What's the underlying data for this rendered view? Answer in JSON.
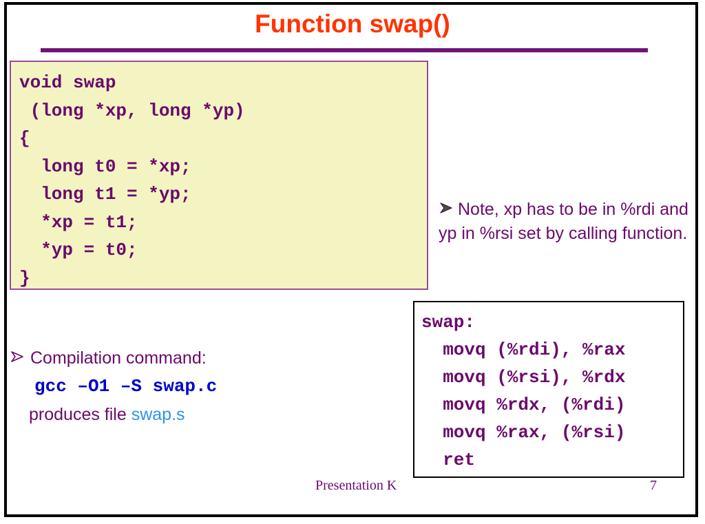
{
  "slide": {
    "title": "Function swap()",
    "accent_title_color": "#FF3300",
    "accent_rule_color": "#70127A",
    "body_text_color": "#6B0A6B",
    "code_bg_color": "#F4F4C2",
    "code_border_color": "#9B4A9B",
    "command_color": "#0000CC",
    "filename_color": "#2E93EE",
    "bullet_green_color": "#1F6B1F"
  },
  "c_code": {
    "lines": [
      "void swap",
      " (long *xp, long *yp)",
      "{",
      "  long t0 = *xp;",
      "  long t1 = *yp;",
      "  *xp = t1;",
      "  *yp = t0;",
      "}"
    ]
  },
  "note": {
    "bullet": "green-arrow-bullet",
    "text": "Note, xp has to be in %rdi and yp in %rsi set by calling function."
  },
  "assembly": {
    "lines": [
      "swap:",
      "  movq (%rdi), %rax",
      "  movq (%rsi), %rdx",
      "  movq %rdx, (%rdi)",
      "  movq %rax, (%rsi)",
      "  ret"
    ]
  },
  "compilation": {
    "bullet": "purple-arrow-bullet",
    "label": "Compilation command:",
    "command": "gcc –O1 –S swap.c",
    "produces_prefix": "produces file ",
    "produces_file": "swap.s"
  },
  "footer": {
    "presentation_name": "Presentation K",
    "page_number": "7"
  }
}
